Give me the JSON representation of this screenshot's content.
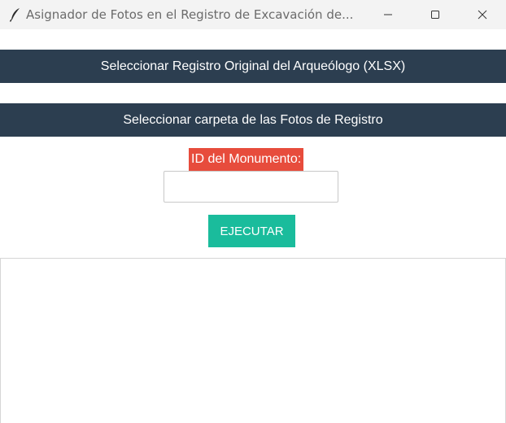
{
  "window": {
    "title": "Asignador de Fotos en el Registro de Excavación de...",
    "icon": "feather-icon",
    "controls": [
      "minimize-icon",
      "maximize-icon",
      "close-icon"
    ]
  },
  "main": {
    "select_xlsx_label": "Seleccionar Registro Original del Arqueólogo (XLSX)",
    "select_folder_label": "Seleccionar carpeta de las Fotos de Registro",
    "monument_id_label": "ID del Monumento:",
    "monument_id_value": "",
    "run_label": "EJECUTAR",
    "log_text": ""
  },
  "colors": {
    "bar_button_bg": "#2c3e50",
    "label_bg": "#e74c3c",
    "run_button_bg": "#1abc9c"
  }
}
